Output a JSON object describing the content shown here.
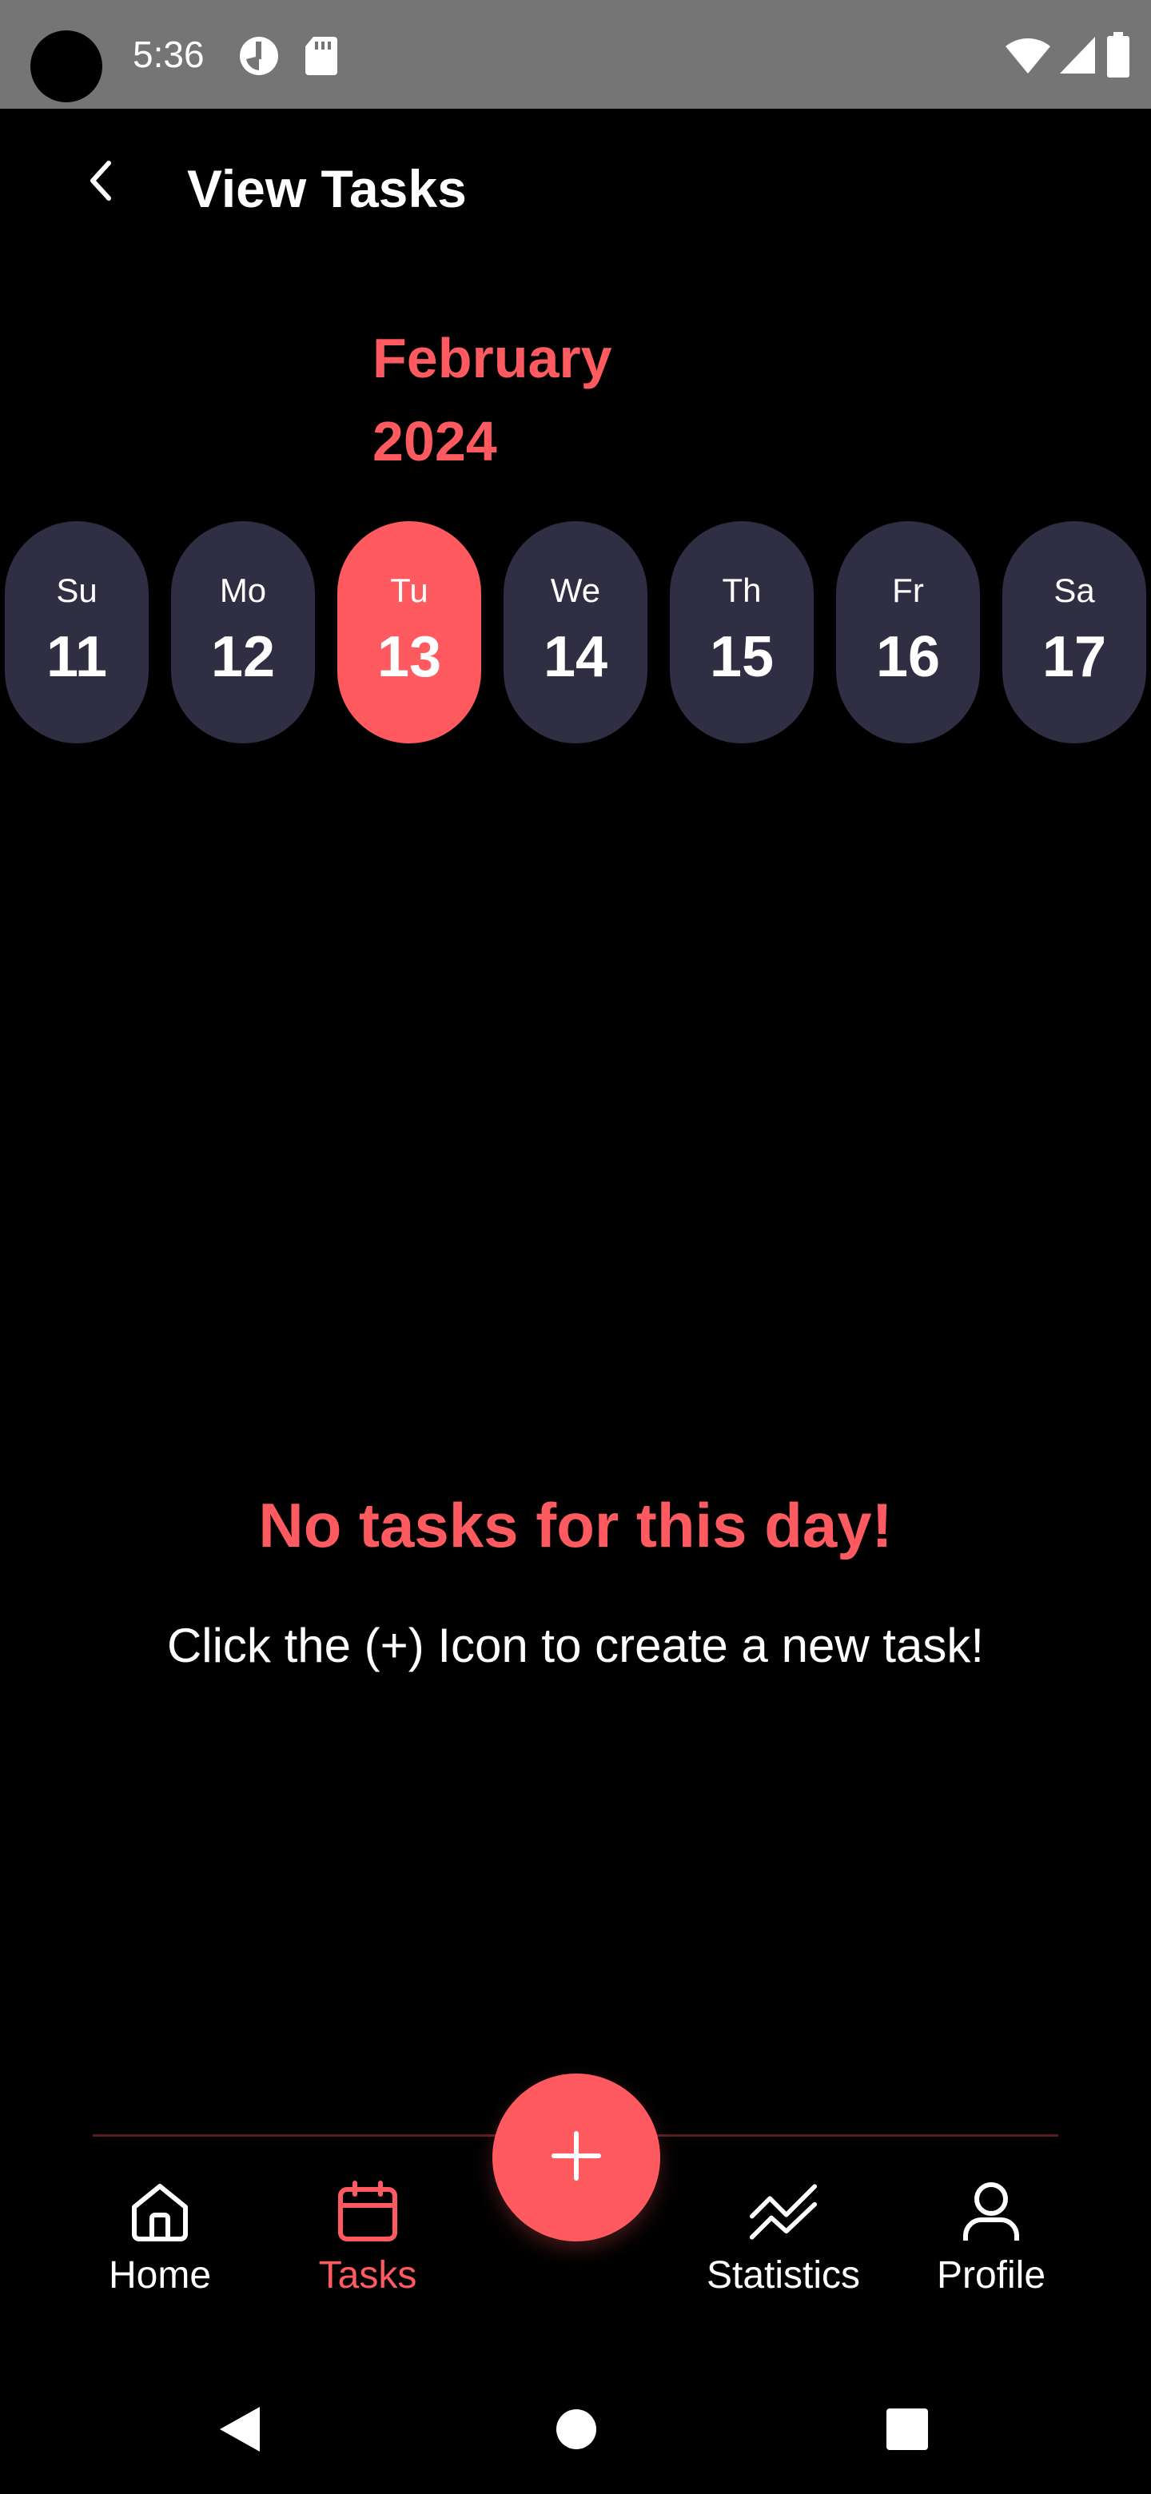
{
  "status_bar": {
    "time": "5:36",
    "icons": [
      "camera-cutout",
      "data-saver-icon",
      "sd-card-icon",
      "wifi-icon",
      "signal-icon",
      "battery-icon"
    ]
  },
  "header": {
    "title": "View Tasks",
    "back_icon": "chevron-left-icon"
  },
  "calendar": {
    "month": "February",
    "year": "2024",
    "selected_day": "13",
    "days": [
      {
        "abbr": "Su",
        "num": "11"
      },
      {
        "abbr": "Mo",
        "num": "12"
      },
      {
        "abbr": "Tu",
        "num": "13"
      },
      {
        "abbr": "We",
        "num": "14"
      },
      {
        "abbr": "Th",
        "num": "15"
      },
      {
        "abbr": "Fr",
        "num": "16"
      },
      {
        "abbr": "Sa",
        "num": "17"
      }
    ]
  },
  "empty_state": {
    "title": "No tasks for this day!",
    "hint": "Click the (+) Icon to create a new task!"
  },
  "bottom_nav": {
    "fab_icon": "plus-icon",
    "active": "Tasks",
    "items": [
      {
        "label": "Home",
        "icon": "home-icon"
      },
      {
        "label": "Tasks",
        "icon": "calendar-icon"
      },
      {
        "label": "Statistics",
        "icon": "chart-line-icon"
      },
      {
        "label": "Profile",
        "icon": "user-icon"
      }
    ]
  },
  "system_nav": [
    "back-triangle-icon",
    "home-circle-icon",
    "recents-square-icon"
  ],
  "colors": {
    "accent": "#ff5a5f",
    "pill": "#2f2e42",
    "background": "#000000",
    "status_bar": "#757575"
  }
}
